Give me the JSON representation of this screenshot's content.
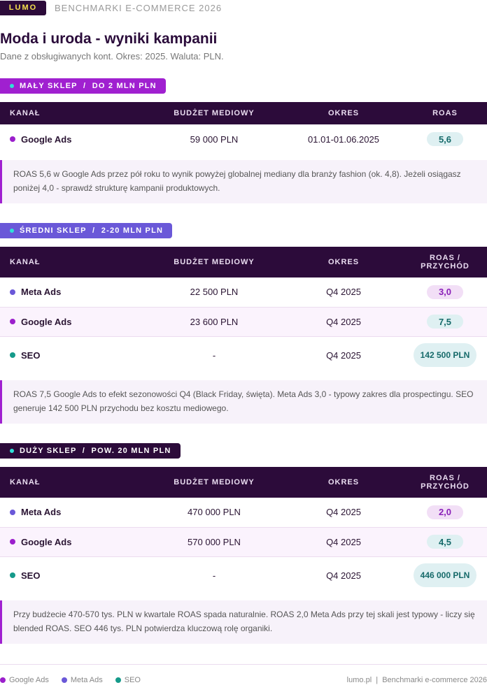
{
  "header": {
    "logo": "LUMO",
    "subtitle": "BENCHMARKI E-COMMERCE 2026"
  },
  "page": {
    "title": "Moda i uroda - wyniki kampanii",
    "subtitle": "Dane z obsługiwanych kont. Okres: 2025. Waluta: PLN."
  },
  "colors": {
    "google_ads": "#9b1fcc",
    "meta_ads": "#6a58d8",
    "seo": "#159a8a",
    "header_bg": "#2c0b3a",
    "accent": "#a020d0"
  },
  "sections": {
    "small": {
      "badge": "MAŁY SKLEP  /  DO 2 MLN PLN",
      "columns": [
        "KANAŁ",
        "BUDŻET MEDIOWY",
        "OKRES",
        "ROAS"
      ],
      "rows": [
        {
          "channel": "Google Ads",
          "budget": "59 000 PLN",
          "period": "01.01-01.06.2025",
          "roas": "5,6"
        }
      ],
      "note": "ROAS 5,6 w Google Ads przez pół roku to wynik powyżej globalnej mediany dla branży fashion (ok. 4,8). Jeżeli osiągasz poniżej 4,0 - sprawdź strukturę kampanii produktowych."
    },
    "mid": {
      "badge": "ŚREDNI SKLEP  /  2-20 MLN PLN",
      "columns": [
        "KANAŁ",
        "BUDŻET MEDIOWY",
        "OKRES",
        "ROAS / PRZYCHÓD"
      ],
      "rows": [
        {
          "channel": "Meta Ads",
          "budget": "22 500 PLN",
          "period": "Q4 2025",
          "roas": "3,0"
        },
        {
          "channel": "Google Ads",
          "budget": "23 600 PLN",
          "period": "Q4 2025",
          "roas": "7,5"
        },
        {
          "channel": "SEO",
          "budget": "-",
          "period": "Q4 2025",
          "roas": "142 500 PLN"
        }
      ],
      "note": "ROAS 7,5 Google Ads to efekt sezonowości Q4 (Black Friday, święta). Meta Ads 3,0 - typowy zakres dla prospectingu. SEO generuje 142 500 PLN przychodu bez kosztu mediowego."
    },
    "big": {
      "badge": "DUŻY SKLEP  /  POW. 20 MLN PLN",
      "columns": [
        "KANAŁ",
        "BUDŻET MEDIOWY",
        "OKRES",
        "ROAS / PRZYCHÓD"
      ],
      "rows": [
        {
          "channel": "Meta Ads",
          "budget": "470 000 PLN",
          "period": "Q4 2025",
          "roas": "2,0"
        },
        {
          "channel": "Google Ads",
          "budget": "570 000 PLN",
          "period": "Q4 2025",
          "roas": "4,5"
        },
        {
          "channel": "SEO",
          "budget": "-",
          "period": "Q4 2025",
          "roas": "446 000 PLN"
        }
      ],
      "note": "Przy budżecie 470-570 tys. PLN w kwartale ROAS spada naturalnie. ROAS 2,0 Meta Ads przy tej skali jest typowy - liczy się blended ROAS. SEO 446 tys. PLN potwierdza kluczową rolę organiki."
    }
  },
  "footer": {
    "legend": [
      "Google Ads",
      "Meta Ads",
      "SEO"
    ],
    "right": "lumo.pl  |  Benchmarki e-commerce 2026"
  }
}
